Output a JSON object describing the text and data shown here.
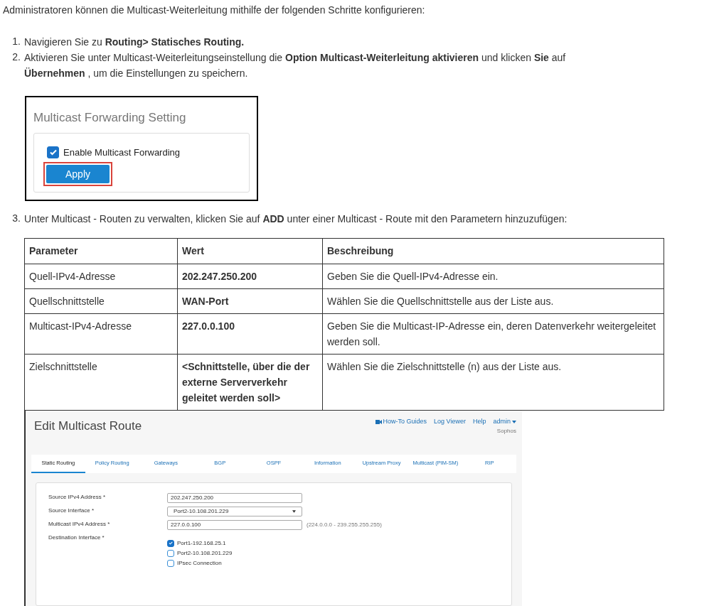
{
  "intro": "Administratoren können die Multicast-Weiterleitung mithilfe der folgenden Schritte konfigurieren:",
  "steps": [
    {
      "number": "1.",
      "text": "Navigieren Sie zu  **Routing> Statisches Routing.**"
    },
    {
      "number": "2.",
      "text": "Aktivieren Sie unter Multicast-Weiterleitungseinstellung die  **Option Multicast-Weiterleitung aktivieren**  und klicken  **Sie** auf **Übernehmen**  , um die Einstellungen zu speichern."
    },
    {
      "number": "3.",
      "text": "Unter Multicast - Routen zu verwalten, klicken Sie  auf **ADD**  unter einer Multicast - Route mit den Parametern hinzuzufügen:"
    }
  ],
  "setting_screenshot": {
    "title": "Multicast Forwarding Setting",
    "checkbox": {
      "label": "Enable Multicast Forwarding",
      "checked": true
    },
    "button": {
      "label": "Apply",
      "highlighted": true
    }
  },
  "table": {
    "columns": [
      "Parameter",
      "Wert",
      "Beschreibung"
    ],
    "rows": [
      [
        "Quell-IPv4-Adresse",
        "202.247.250.200",
        "Geben Sie die Quell-IPv4-Adresse ein."
      ],
      [
        "Quellschnittstelle",
        "WAN-Port",
        "Wählen Sie die Quellschnittstelle aus der Liste aus."
      ],
      [
        "Multicast-IPv4-Adresse",
        "227.0.0.100",
        "Geben Sie die Multicast-IP-Adresse ein, deren Datenverkehr weitergeleitet werden soll."
      ],
      [
        "Zielschnittstelle",
        "<Schnittstelle, über die der externe Serververkehr geleitet werden soll>",
        "Wählen Sie die Zielschnittstelle (n) aus der Liste aus."
      ]
    ]
  },
  "route_screenshot": {
    "title": "Edit Multicast Route",
    "links": [
      "How-To Guides",
      "Log Viewer",
      "Help"
    ],
    "user": "admin",
    "org": "Sophos",
    "tabs": [
      {
        "label": "Static Routing",
        "selected": true
      },
      {
        "label": "Policy Routing",
        "selected": false
      },
      {
        "label": "Gateways",
        "selected": false
      },
      {
        "label": "BGP",
        "selected": false
      },
      {
        "label": "OSPF",
        "selected": false
      },
      {
        "label": "Information",
        "selected": false
      },
      {
        "label": "Upstream Proxy",
        "selected": false
      },
      {
        "label": "Multicast (PIM-SM)",
        "selected": false
      },
      {
        "label": "RIP",
        "selected": false
      }
    ],
    "fields": [
      {
        "kind": "text",
        "label": "Source IPv4 Address *",
        "value": "202.247.250.200"
      },
      {
        "kind": "select",
        "label": "Source Interface *",
        "value": "Port2-10.108.201.229"
      },
      {
        "kind": "text",
        "label": "Multicast IPv4 Address *",
        "value": "227.0.0.100",
        "hint": "(224.0.0.0 - 239.255.255.255)"
      },
      {
        "kind": "checklist",
        "label": "Destination Interface *",
        "options": [
          {
            "label": "Port1-192.168.25.1",
            "checked": true
          },
          {
            "label": "Port2-10.108.201.229",
            "checked": false
          },
          {
            "label": "IPsec Connection",
            "checked": false
          }
        ]
      }
    ]
  }
}
